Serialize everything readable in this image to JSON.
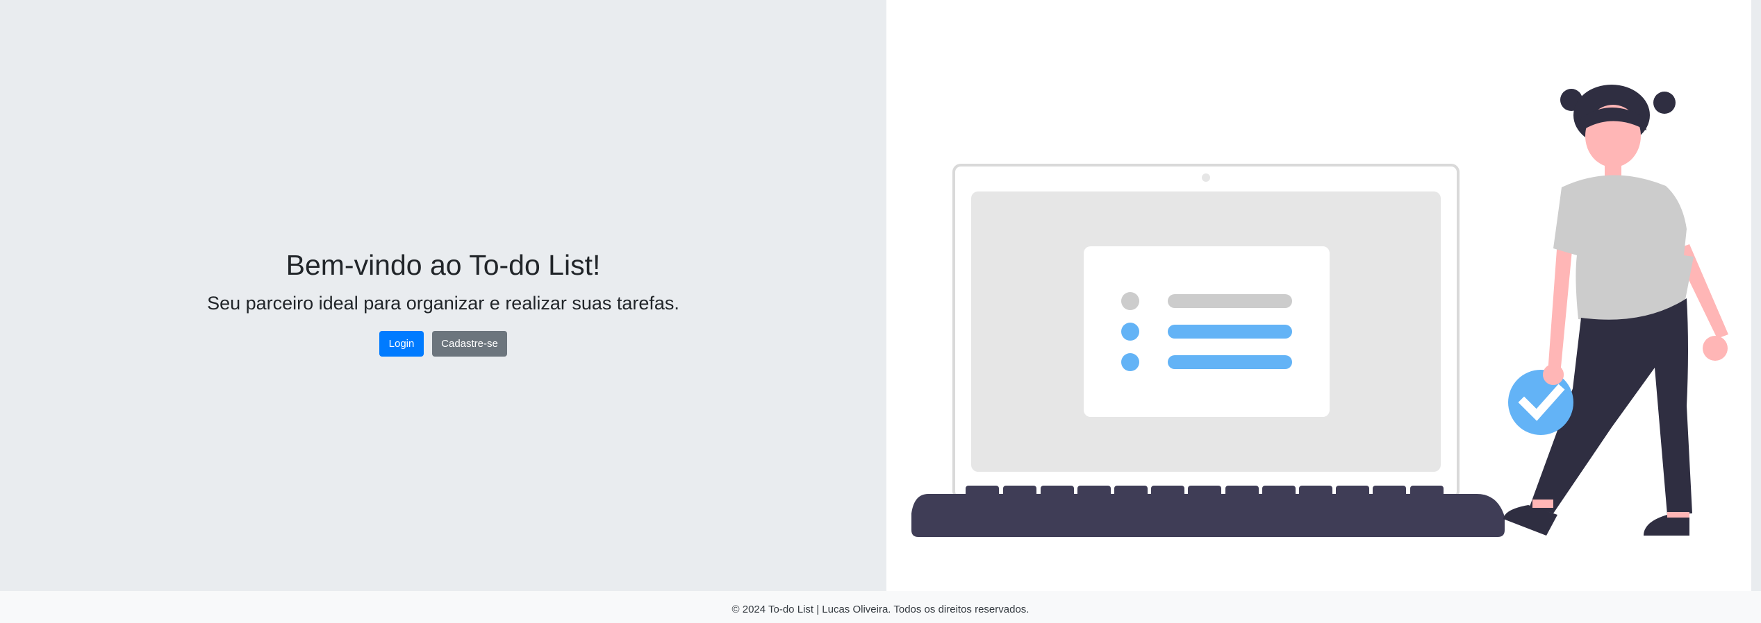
{
  "hero": {
    "title": "Bem-vindo ao To-do List!",
    "subtitle": "Seu parceiro ideal para organizar e realizar suas tarefas."
  },
  "buttons": {
    "login_label": "Login",
    "signup_label": "Cadastre-se"
  },
  "footer": {
    "text": "© 2024 To-do List | Lucas Oliveira. Todos os direitos reservados."
  },
  "illustration": {
    "semantic": "person-beside-laptop-todo-list-illustration",
    "colors": {
      "accent_blue": "#63b3f6",
      "dark": "#3f3d56",
      "skin": "#ffb6b6",
      "grey": "#cccccc",
      "screen": "#e6e6e6"
    }
  },
  "colors": {
    "left_bg": "#e9ecef",
    "right_bg": "#ffffff",
    "primary": "#007bff",
    "secondary": "#6c757d",
    "footer_bg": "#f8f9fa"
  }
}
